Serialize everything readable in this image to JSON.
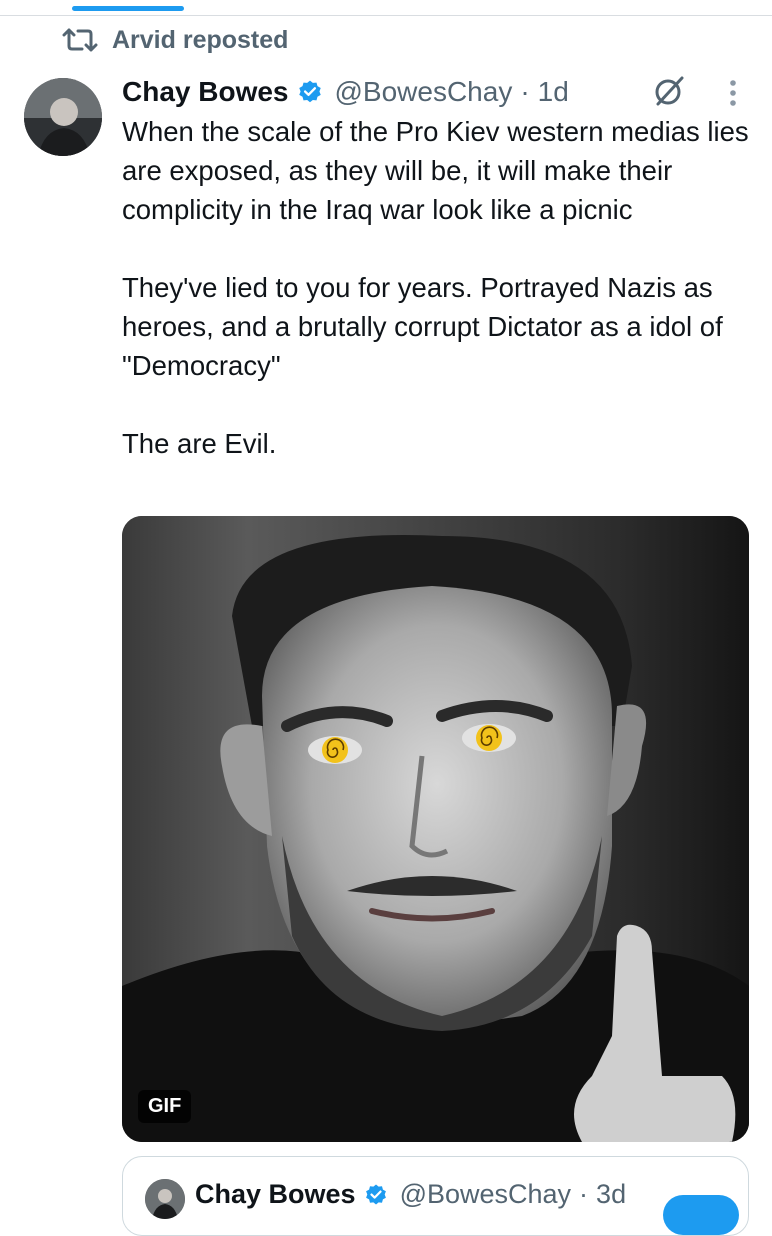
{
  "repost": {
    "label": "Arvid reposted",
    "icon": "repost-icon"
  },
  "tweet": {
    "author_name": "Chay Bowes",
    "handle": "@BowesChay",
    "separator": "·",
    "time": "1d",
    "verified": true,
    "text_paragraphs": [
      "When the scale of the Pro Kiev western medias lies are exposed, as they will be, it will make their complicity in the Iraq war look like a picnic",
      "They've lied to you for years. Portrayed Nazis as heroes, and a brutally corrupt Dictator as a idol of \"Democracy\"",
      "The are Evil."
    ],
    "media_badge": "GIF"
  },
  "quoted_tweet": {
    "author_name": "Chay Bowes",
    "handle": "@BowesChay",
    "separator": "·",
    "time": "3d"
  },
  "colors": {
    "accent": "#1d9bf0",
    "secondary_text": "#536471",
    "primary_text": "#0f1419",
    "eye_yellow": "#f2c21b"
  }
}
